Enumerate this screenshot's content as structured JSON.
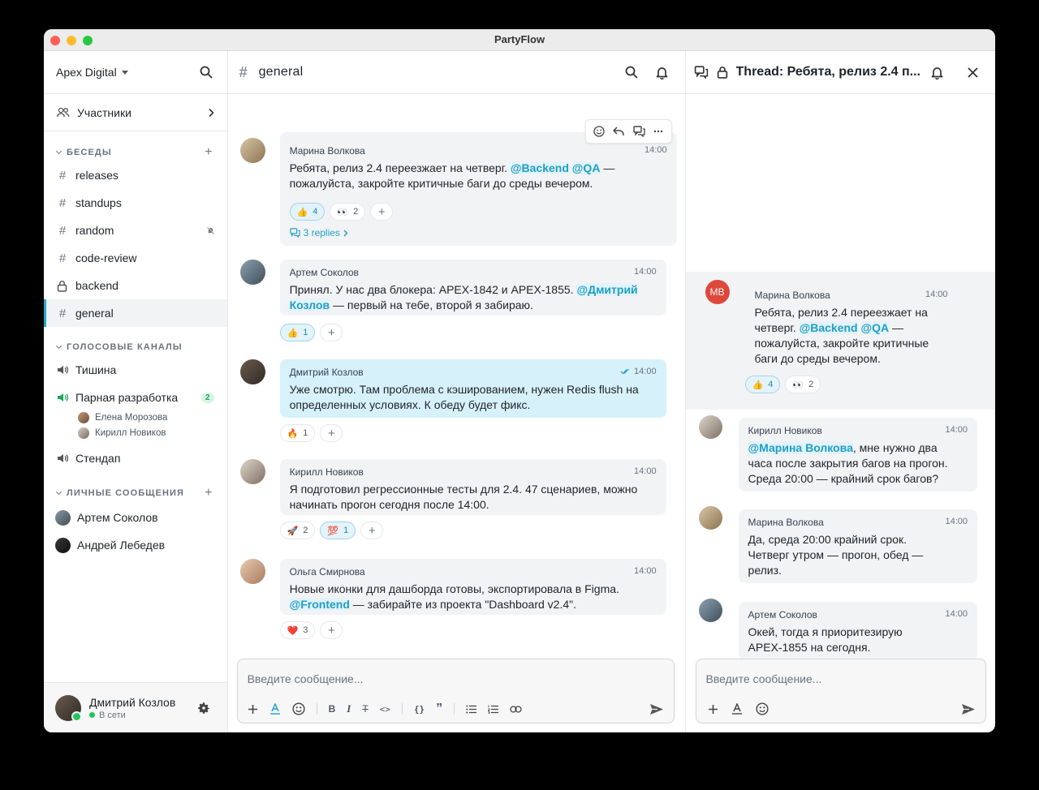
{
  "window": {
    "title": "PartyFlow"
  },
  "sidebar": {
    "workspace": "Apex Digital",
    "members_label": "Участники",
    "conversations_header": "БЕСЕДЫ",
    "channels": [
      {
        "name": "releases",
        "type": "public"
      },
      {
        "name": "standups",
        "type": "public"
      },
      {
        "name": "random",
        "type": "public",
        "muted": true
      },
      {
        "name": "code-review",
        "type": "public"
      },
      {
        "name": "backend",
        "type": "private"
      },
      {
        "name": "general",
        "type": "public",
        "active": true
      }
    ],
    "voice_header": "ГОЛОСОВЫЕ КАНАЛЫ",
    "voice_channels": [
      {
        "name": "Тишина"
      },
      {
        "name": "Парная разработка",
        "count": "2",
        "users": [
          "Елена Морозова",
          "Кирилл Новиков"
        ]
      },
      {
        "name": "Стендап"
      }
    ],
    "dm_header": "ЛИЧНЫЕ СООБЩЕНИЯ",
    "dms": [
      {
        "name": "Артем Соколов"
      },
      {
        "name": "Андрей Лебедев"
      }
    ],
    "me": {
      "name": "Дмитрий Козлов",
      "status": "В сети"
    }
  },
  "main": {
    "channel": "general",
    "messages": [
      {
        "author": "Марина Волкова",
        "time": "14:00",
        "text_1": "Ребята, релиз 2.4 переезжает на четверг. ",
        "mention_1": "@Backend",
        "mention_2": "@QA",
        "text_2": " —",
        "text_3": "пожалуйста, закройте критичные баги до среды вечером.",
        "reactions": [
          {
            "emoji": "👍",
            "count": "4"
          },
          {
            "emoji": "👀",
            "count": "2"
          }
        ],
        "replies": "3 replies"
      },
      {
        "author": "Артем Соколов",
        "time": "14:00",
        "text_1": "Принял. У нас два блокера: APEX-1842 и APEX-1855. ",
        "mention_1": "@Дмитрий",
        "mention_2": "Козлов",
        "text_2": " — первый на тебе, второй я забираю.",
        "reactions": [
          {
            "emoji": "👍",
            "count": "1"
          }
        ]
      },
      {
        "author": "Дмитрий Козлов",
        "time": "14:00",
        "text_1": "Уже смотрю. Там проблема с кэшированием, нужен Redis flush на",
        "text_2": "определенных условиях. К обеду будет фикс.",
        "reactions": [
          {
            "emoji": "🔥",
            "count": "1"
          }
        ]
      },
      {
        "author": "Кирилл Новиков",
        "time": "14:00",
        "text_1": "Я подготовил регрессионные тесты для 2.4. 47 сценариев, можно",
        "text_2": "начинать прогон сегодня после 14:00.",
        "reactions": [
          {
            "emoji": "🚀",
            "count": "2"
          },
          {
            "emoji": "💯",
            "count": "1"
          }
        ]
      },
      {
        "author": "Ольга Смирнова",
        "time": "14:00",
        "text_1": "Новые иконки для дашборда готовы, экспортировала в Figma.",
        "mention_1": "@Frontend",
        "text_2": " — забирайте из проекта \"Dashboard v2.4\".",
        "reactions": [
          {
            "emoji": "❤️",
            "count": "3"
          }
        ]
      }
    ],
    "composer_placeholder": "Введите сообщение..."
  },
  "thread": {
    "title": "Thread: Ребята, релиз 2.4 п...",
    "root": {
      "initials": "МВ",
      "author": "Марина Волкова",
      "time": "14:00",
      "line_1": "Ребята, релиз 2.4 переезжает на",
      "line_2a": "четверг. ",
      "mention_1": "@Backend",
      "mention_2": "@QA",
      "line_2b": " —",
      "line_3": "пожалуйста, закройте критичные",
      "line_4": "баги до среды вечером.",
      "reactions": [
        {
          "emoji": "👍",
          "count": "4"
        },
        {
          "emoji": "👀",
          "count": "2"
        }
      ]
    },
    "replies": [
      {
        "author": "Кирилл Новиков",
        "time": "14:00",
        "mention": "@Марина Волкова",
        "line_1": ", мне нужно два",
        "line_2": "часа после закрытия багов на прогон.",
        "line_3": "Среда 20:00 — крайний срок багов?"
      },
      {
        "author": "Марина Волкова",
        "time": "14:00",
        "line_1": "Да, среда 20:00 крайний срок.",
        "line_2": "Четверг утром — прогон, обед —",
        "line_3": "релиз."
      },
      {
        "author": "Артем Соколов",
        "time": "14:00",
        "line_1": "Окей, тогда я приоритезирую",
        "line_2": "APEX-1855 на сегодня."
      }
    ],
    "composer_placeholder": "Введите сообщение..."
  },
  "colors": {
    "accent": "#2aa7c9",
    "mention": "#1e9fc7",
    "online": "#22c55e",
    "avatar_mv": "#e0473b"
  }
}
